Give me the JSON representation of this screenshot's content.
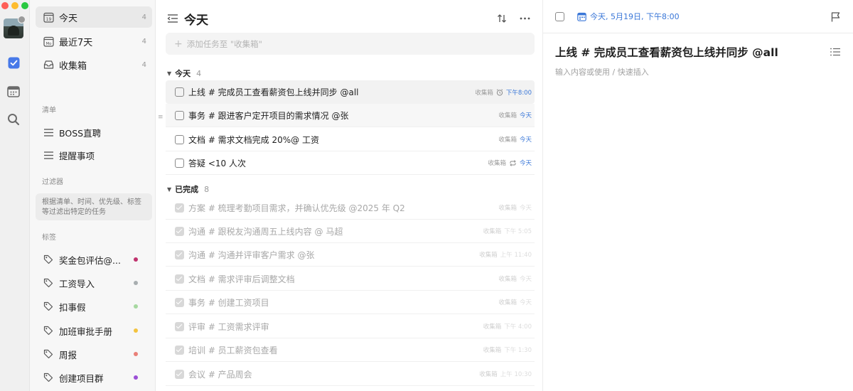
{
  "rail": {
    "traffic_colors": [
      "#fe5f57",
      "#febc2e",
      "#28c840"
    ],
    "icons": [
      "checkbox-icon",
      "calendar-icon",
      "search-icon"
    ]
  },
  "sidebar": {
    "smart_lists": [
      {
        "label": "今天",
        "count": "4",
        "icon": "calendar-day-icon",
        "day": "19"
      },
      {
        "label": "最近7天",
        "count": "4",
        "icon": "calendar-week-icon",
        "day": "Mo"
      },
      {
        "label": "收集箱",
        "count": "4",
        "icon": "inbox-icon"
      }
    ],
    "lists_title": "清单",
    "lists": [
      {
        "label": "BOSS直聘"
      },
      {
        "label": "提醒事项"
      }
    ],
    "filters_title": "过滤器",
    "filters_hint": "根据清单、时间、优先级、标签等过滤出特定的任务",
    "tags_title": "标签",
    "tags": [
      {
        "label": "奖金包评估@...",
        "color": "#c0336e"
      },
      {
        "label": "工资导入",
        "color": "#a8aeb0"
      },
      {
        "label": "扣事假",
        "color": "#a6d8a0"
      },
      {
        "label": "加班审批手册",
        "color": "#f3c33f"
      },
      {
        "label": "周报",
        "color": "#e98078"
      },
      {
        "label": "创建项目群",
        "color": "#9b4fd6"
      }
    ]
  },
  "main": {
    "title": "今天",
    "add_placeholder": "添加任务至 \"收集箱\"",
    "today_group": {
      "name": "今天",
      "count": "4"
    },
    "today_tasks": [
      {
        "text": "上线 # 完成员工查看薪资包上线并同步 @all",
        "list": "收集箱",
        "due": "下午8:00",
        "due_icon": "alarm-icon"
      },
      {
        "text": "事务 # 跟进客户定开项目的需求情况 @张",
        "list": "收集箱",
        "due": "今天",
        "due_icon": ""
      },
      {
        "text": "文档 # 需求文档完成 20%@ 工资",
        "list": "收集箱",
        "due": "今天",
        "due_icon": ""
      },
      {
        "text": "答疑 <10 人次",
        "list": "收集箱",
        "due": "今天",
        "due_icon": "repeat-icon"
      }
    ],
    "done_group": {
      "name": "已完成",
      "count": "8"
    },
    "done_tasks": [
      {
        "text": "方案 # 梳理考勤项目需求，并确认优先级 @2025 年 Q2",
        "list": "收集箱",
        "due": "今天"
      },
      {
        "text": "沟通 # 跟税友沟通周五上线内容 @ 马超",
        "list": "收集箱",
        "due": "下午 5:05"
      },
      {
        "text": "沟通 # 沟通并评审客户需求 @张",
        "list": "收集箱",
        "due": "上午 11:40"
      },
      {
        "text": "文档 # 需求评审后调整文档",
        "list": "收集箱",
        "due": "今天"
      },
      {
        "text": "事务 # 创建工资项目",
        "list": "收集箱",
        "due": "今天"
      },
      {
        "text": "评审 # 工资需求评审",
        "list": "收集箱",
        "due": "下午 4:00"
      },
      {
        "text": "培训 # 员工薪资包查看",
        "list": "收集箱",
        "due": "下午 1:30"
      },
      {
        "text": "会议 # 产品周会",
        "list": "收集箱",
        "due": "上午 10:30"
      }
    ]
  },
  "detail": {
    "date": "今天, 5月19日, 下午8:00",
    "title": "上线 # 完成员工查看薪资包上线并同步 @all",
    "placeholder": "输入内容或使用 / 快速插入",
    "accent": "#3a77d8"
  }
}
